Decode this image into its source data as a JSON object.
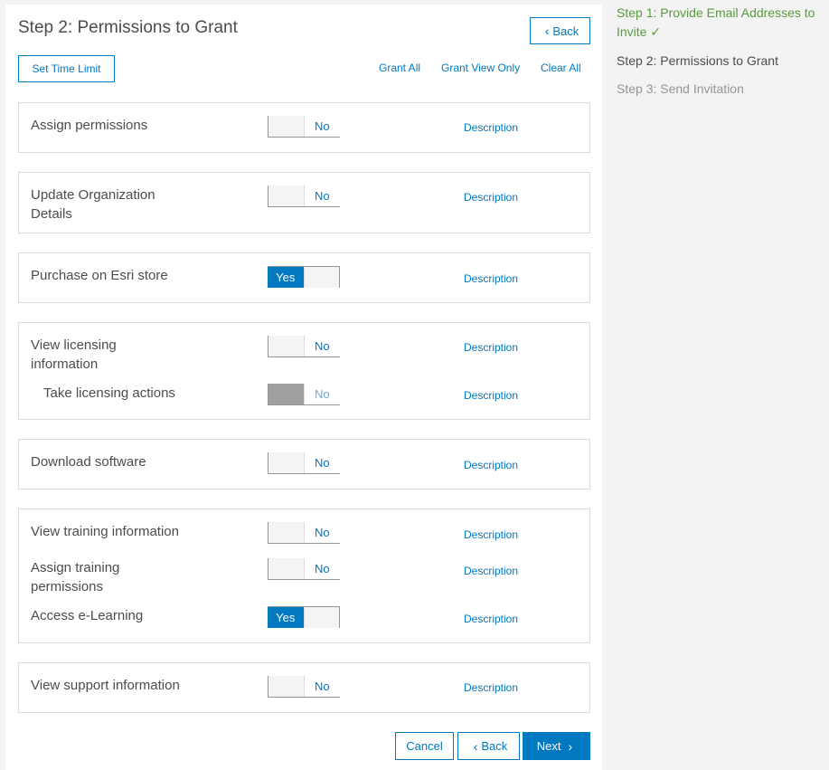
{
  "title": "Step 2: Permissions to Grant",
  "buttons": {
    "back_top": "Back",
    "set_time_limit": "Set Time Limit",
    "cancel": "Cancel",
    "back_bottom": "Back",
    "next": "Next"
  },
  "links": {
    "grant_all": "Grant All",
    "grant_view_only": "Grant View Only",
    "clear_all": "Clear All"
  },
  "description_label": "Description",
  "permissions": {
    "assign_permissions": {
      "label": "Assign permissions",
      "state": "No"
    },
    "update_org": {
      "label": "Update Organization Details",
      "state": "No"
    },
    "purchase_esri": {
      "label": "Purchase on Esri store",
      "state": "Yes"
    },
    "view_licensing": {
      "label": "View licensing information",
      "state": "No"
    },
    "take_licensing": {
      "label": "Take licensing actions",
      "state": "No"
    },
    "download_software": {
      "label": "Download software",
      "state": "No"
    },
    "view_training": {
      "label": "View training information",
      "state": "No"
    },
    "assign_training": {
      "label": "Assign training permissions",
      "state": "No"
    },
    "access_elearning": {
      "label": "Access e-Learning",
      "state": "Yes"
    },
    "view_support": {
      "label": "View support information",
      "state": "No"
    }
  },
  "steps": {
    "step1": "Step 1: Provide Email Addresses to Invite",
    "step2": "Step 2: Permissions to Grant",
    "step3": "Step 3: Send Invitation"
  },
  "colors": {
    "accent": "#0079c1",
    "complete": "#5a9a3f"
  }
}
